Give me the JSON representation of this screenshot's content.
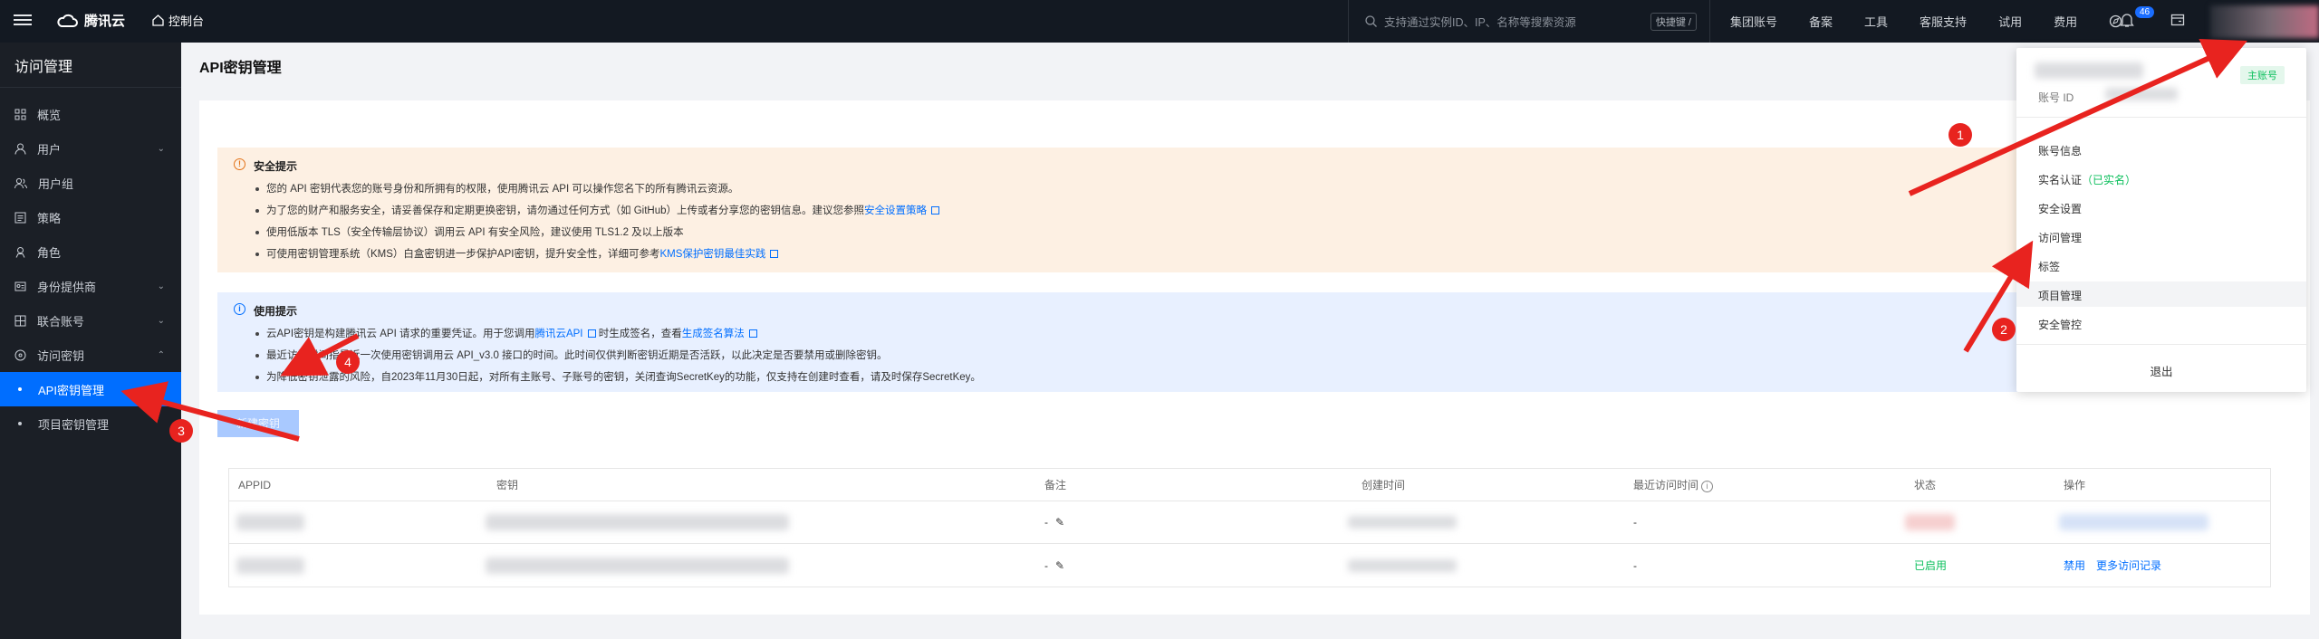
{
  "topbar": {
    "brand": "腾讯云",
    "console": "控制台",
    "search_placeholder": "支持通过实例ID、IP、名称等搜索资源",
    "shortcut": "快捷键 /",
    "nav": [
      "集团账号",
      "备案",
      "工具",
      "客服支持",
      "试用",
      "费用"
    ],
    "notification_count": "46"
  },
  "sidebar": {
    "title": "访问管理",
    "items": [
      {
        "label": "概览",
        "icon": "grid-icon"
      },
      {
        "label": "用户",
        "icon": "user-icon"
      },
      {
        "label": "用户组",
        "icon": "users-icon"
      },
      {
        "label": "策略",
        "icon": "policy-icon"
      },
      {
        "label": "角色",
        "icon": "role-icon"
      },
      {
        "label": "身份提供商",
        "icon": "idp-icon"
      },
      {
        "label": "联合账号",
        "icon": "federated-icon"
      },
      {
        "label": "访问密钥",
        "icon": "key-icon"
      },
      {
        "label": "API密钥管理"
      },
      {
        "label": "项目密钥管理"
      }
    ]
  },
  "main": {
    "title": "API密钥管理",
    "warning": {
      "title": "安全提示",
      "l1": "您的 API 密钥代表您的账号身份和所拥有的权限，使用腾讯云 API 可以操作您名下的所有腾讯云资源。",
      "l2a": "为了您的财产和服务安全，请妥善保存和定期更换密钥，请勿通过任何方式（如 GitHub）上传或者分享您的密钥信息。建议您参照",
      "l2link": "安全设置策略",
      "l3": "使用低版本 TLS（安全传输层协议）调用云 API 有安全风险，建议使用 TLS1.2 及以上版本",
      "l4a": "可使用密钥管理系统（KMS）白盒密钥进一步保护API密钥，提升安全性，详细可参考",
      "l4link": "KMS保护密钥最佳实践"
    },
    "info": {
      "title": "使用提示",
      "l1a": "云API密钥是构建腾讯云 API 请求的重要凭证。用于您调用",
      "l1link": "腾讯云API",
      "l1b": "时生成签名，查看",
      "l1link2": "生成签名算法",
      "l2": "最近访问时间指最近一次使用密钥调用云 API_v3.0 接口的时间。此时间仅供判断密钥近期是否活跃，以此决定是否要禁用或删除密钥。",
      "l3": "为降低密钥泄露的风险，自2023年11月30日起，对所有主账号、子账号的密钥，关闭查询SecretKey的功能，仅支持在创建时查看，请及时保存SecretKey。"
    },
    "new_key_button": "新建密钥",
    "table": {
      "headers": [
        "APPID",
        "密钥",
        "备注",
        "创建时间",
        "最近访问时间",
        "状态",
        "操作"
      ],
      "rows": [
        {
          "note": "-",
          "last_access": "-",
          "status": "",
          "ops": []
        },
        {
          "note": "-",
          "last_access": "-",
          "status": "已启用",
          "ops": [
            "禁用",
            "更多访问记录"
          ]
        }
      ]
    }
  },
  "dropdown": {
    "main_account": "主账号",
    "account_id_label": "账号 ID",
    "items": [
      "账号信息",
      "实名认证",
      "安全设置",
      "访问管理",
      "标签",
      "项目管理",
      "安全管控"
    ],
    "verified": "（已实名）",
    "logout": "退出"
  },
  "annotations": {
    "markers": [
      "1",
      "2",
      "3",
      "4"
    ],
    "color": "#e8231f"
  }
}
